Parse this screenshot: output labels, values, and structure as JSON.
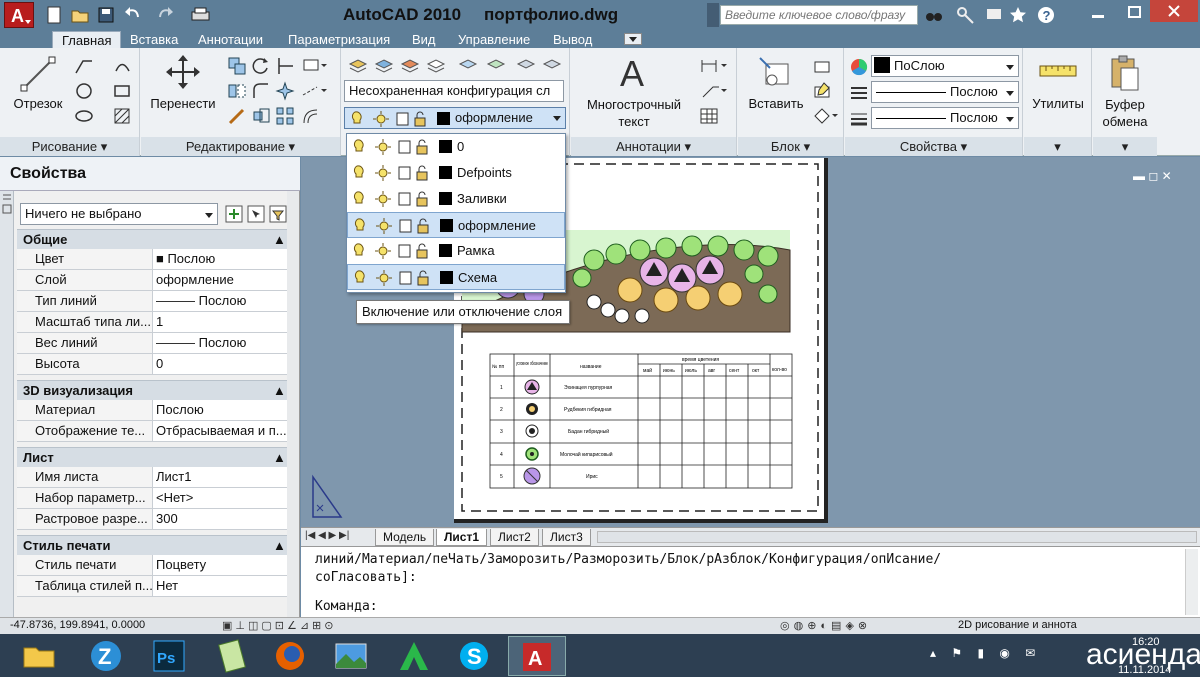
{
  "window": {
    "app_title": "AutoCAD 2010",
    "file_title": "портфолио.dwg",
    "search_placeholder": "Введите ключевое слово/фразу"
  },
  "ribbon_tabs": [
    "Главная",
    "Вставка",
    "Аннотации",
    "Параметризация",
    "Вид",
    "Управление",
    "Вывод"
  ],
  "panels": {
    "draw": {
      "title": "Рисование",
      "otrezok": "Отрезок"
    },
    "modify": {
      "title": "Редактирование",
      "move": "Перенести"
    },
    "layers": {
      "state_combo": "Несохраненная конфигурация сл",
      "current_layer": "оформление"
    },
    "annotation": {
      "title": "Аннотации",
      "mtext": "Многострочный текст"
    },
    "block": {
      "title": "Блок",
      "insert": "Вставить"
    },
    "properties": {
      "title": "Свойства",
      "color": "ПоСлою",
      "linetype": "Послою",
      "lineweight": "Послою"
    },
    "utilities": {
      "label": "Утилиты"
    },
    "clipboard": {
      "label": "Буфер обмена"
    }
  },
  "layer_dropdown": [
    {
      "name": "0",
      "selected": false
    },
    {
      "name": "Defpoints",
      "selected": false
    },
    {
      "name": "Заливки",
      "selected": false
    },
    {
      "name": "оформление",
      "selected": true
    },
    {
      "name": "Рамка",
      "selected": false
    },
    {
      "name": "Схема",
      "selected": true
    }
  ],
  "tooltip": "Включение или отключение слоя",
  "props_palette": {
    "title": "Свойства",
    "selection": "Ничего не выбрано",
    "sections": [
      {
        "name": "Общие",
        "rows": [
          [
            "Цвет",
            "■ Послою"
          ],
          [
            "Слой",
            "оформление"
          ],
          [
            "Тип линий",
            "——— Послою"
          ],
          [
            "Масштаб типа ли...",
            "1"
          ],
          [
            "Вес линий",
            "——— Послою"
          ],
          [
            "Высота",
            "0"
          ]
        ]
      },
      {
        "name": "3D визуализация",
        "rows": [
          [
            "Материал",
            "Послою"
          ],
          [
            "Отображение те...",
            "Отбрасываемая и п..."
          ]
        ]
      },
      {
        "name": "Лист",
        "rows": [
          [
            "Имя листа",
            "Лист1"
          ],
          [
            "Набор параметр...",
            "<Нет>"
          ],
          [
            "Растровое разре...",
            "300"
          ]
        ]
      },
      {
        "name": "Стиль печати",
        "rows": [
          [
            "Стиль печати",
            "Поцвету"
          ],
          [
            "Таблица стилей п...",
            "Нет"
          ]
        ]
      }
    ]
  },
  "legend_table": {
    "headers": {
      "num": "№ пп",
      "symbol": "условное обозначение",
      "name": "название",
      "bloom": "время цветения",
      "qty": "кол-во"
    },
    "months": [
      "май",
      "июнь",
      "июль",
      "авг",
      "сент",
      "окт"
    ],
    "rows": [
      [
        "1",
        "Эхинацея пурпурная"
      ],
      [
        "2",
        "Рудбекия гибридная"
      ],
      [
        "3",
        "Бадан гибридный"
      ],
      [
        "4",
        "Молочай кипарисовый"
      ],
      [
        "5",
        "Ирис"
      ]
    ]
  },
  "layout_tabs": [
    "Модель",
    "Лист1",
    "Лист2",
    "Лист3"
  ],
  "command": {
    "line1": "линий/Материал/пеЧать/Заморозить/Разморозить/Блок/рАзблок/Конфигурация/опИсание/",
    "line2": "соГласовать]:",
    "prompt": "Команда:"
  },
  "status": {
    "coords": "-47.8736, 199.8941, 0.0000",
    "workspace": "2D рисование и аннота"
  },
  "taskbar": {
    "time": "16:20",
    "date": "11.11.2014",
    "watermark": "асиенда.ру"
  }
}
